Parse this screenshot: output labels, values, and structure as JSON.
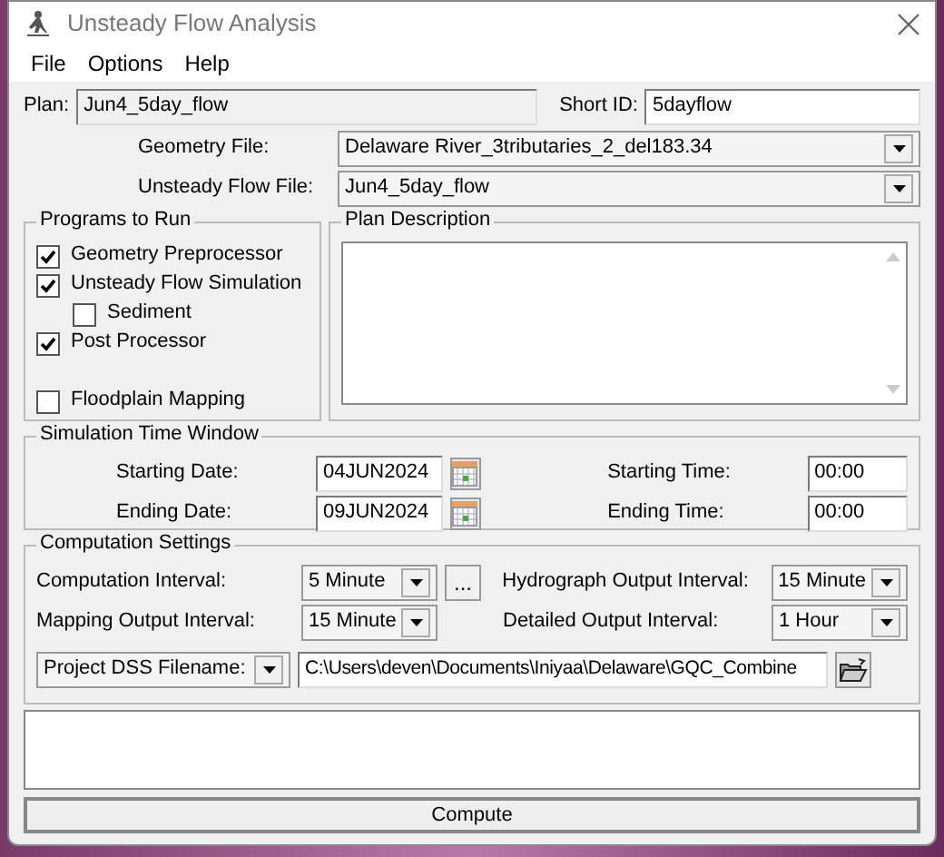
{
  "window": {
    "title": "Unsteady Flow Analysis"
  },
  "menu": [
    "File",
    "Options",
    "Help"
  ],
  "plan": {
    "label": "Plan:",
    "value": "Jun4_5day_flow"
  },
  "short_id": {
    "label": "Short ID:",
    "value": "5dayflow"
  },
  "geometry_file": {
    "label": "Geometry File:",
    "value": "Delaware River_3tributaries_2_del183.34"
  },
  "unsteady_flow_file": {
    "label": "Unsteady Flow File:",
    "value": "Jun4_5day_flow"
  },
  "programs_to_run": {
    "title": "Programs to Run",
    "items": [
      {
        "label": "Geometry Preprocessor",
        "checked": true
      },
      {
        "label": "Unsteady Flow Simulation",
        "checked": true,
        "children": [
          {
            "label": "Sediment",
            "checked": false
          }
        ]
      },
      {
        "label": "Post Processor",
        "checked": true
      },
      {
        "label": "Floodplain Mapping",
        "checked": false
      }
    ]
  },
  "plan_description": {
    "title": "Plan Description"
  },
  "simulation_time_window": {
    "title": "Simulation Time Window",
    "starting_date": {
      "label": "Starting Date:",
      "value": "04JUN2024"
    },
    "ending_date": {
      "label": "Ending Date:",
      "value": "09JUN2024"
    },
    "starting_time": {
      "label": "Starting Time:",
      "value": "00:00"
    },
    "ending_time": {
      "label": "Ending Time:",
      "value": "00:00"
    }
  },
  "computation_settings": {
    "title": "Computation Settings",
    "computation_interval": {
      "label": "Computation Interval:",
      "value": "5 Minute"
    },
    "more_button": "...",
    "hydrograph_output_interval": {
      "label": "Hydrograph Output Interval:",
      "value": "15 Minute"
    },
    "mapping_output_interval": {
      "label": "Mapping Output Interval:",
      "value": "15 Minute"
    },
    "detailed_output_interval": {
      "label": "Detailed Output Interval:",
      "value": "1 Hour"
    },
    "dss_file": {
      "label": "Project DSS Filename:",
      "value": "C:\\Users\\deven\\Documents\\Iniyaa\\Delaware\\GQC_Combine"
    }
  },
  "compute_button": "Compute"
}
